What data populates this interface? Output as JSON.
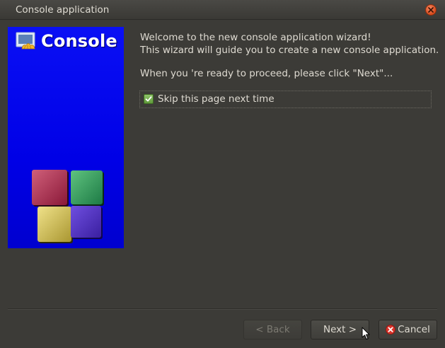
{
  "window": {
    "title": "Console application"
  },
  "banner": {
    "heading": "Console",
    "background_color": "#0000e6",
    "icon": "console-app-icon",
    "logo": "cube-logo"
  },
  "content": {
    "welcome_line1": "Welcome to the new console application wizard!",
    "welcome_line2": "This wizard will guide you to create a new console application.",
    "proceed_text": "When you 're ready to proceed, please click \"Next\"...",
    "skip_checkbox": {
      "label": "Skip this page next time",
      "checked": true
    }
  },
  "buttons": {
    "back_label": "< Back",
    "back_enabled": false,
    "next_label": "Next >",
    "cancel_label": "Cancel"
  },
  "colors": {
    "window_bg": "#3c3b37",
    "text": "#dfdbd2",
    "close_button": "#d64a1c",
    "checkbox": "#6fa84a"
  }
}
